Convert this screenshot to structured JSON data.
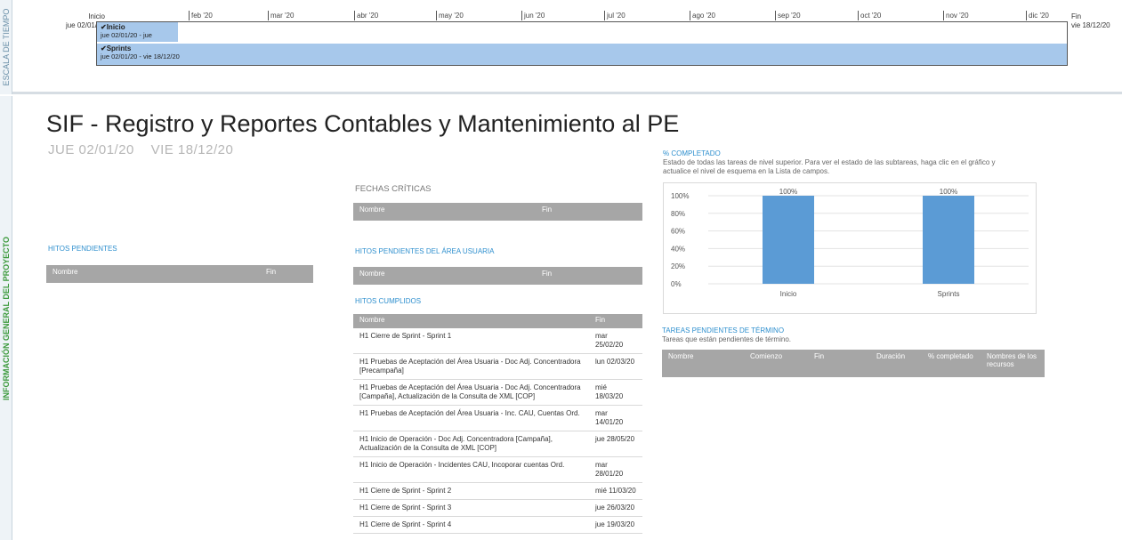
{
  "side_labels": {
    "timeline": "ESCALA DE TIEMPO",
    "info": "INFORMACIÓN GENERAL DEL PROYECTO"
  },
  "timeline": {
    "start_label": "Inicio",
    "start_date": "jue 02/01/20",
    "end_label": "Fin",
    "end_date": "vie 18/12/20",
    "months": [
      "feb '20",
      "mar '20",
      "abr '20",
      "may '20",
      "jun '20",
      "jul '20",
      "ago '20",
      "sep '20",
      "oct '20",
      "nov '20",
      "dic '20"
    ],
    "bars": [
      {
        "name": "Inicio",
        "dates": "jue 02/01/20 - jue"
      },
      {
        "name": "Sprints",
        "dates": "jue 02/01/20 - vie 18/12/20"
      }
    ]
  },
  "project": {
    "title": "SIF - Registro y Reportes Contables y Mantenimiento al PE",
    "start": "JUE 02/01/20",
    "end": "VIE 18/12/20"
  },
  "sections": {
    "hitos_pendientes": {
      "heading": "HITOS PENDIENTES",
      "col_name": "Nombre",
      "col_end": "Fin"
    },
    "fechas_criticas": {
      "heading": "FECHAS CRÍTICAS",
      "col_name": "Nombre",
      "col_end": "Fin"
    },
    "hitos_area": {
      "heading": "HITOS PENDIENTES DEL ÁREA USUARIA",
      "col_name": "Nombre",
      "col_end": "Fin"
    },
    "hitos_cumplidos": {
      "heading": "HITOS CUMPLIDOS",
      "col_name": "Nombre",
      "col_end": "Fin",
      "rows": [
        {
          "name": "H1 Cierre de Sprint - Sprint 1",
          "end": "mar 25/02/20"
        },
        {
          "name": "H1 Pruebas de Aceptación del Área Usuaria - Doc Adj. Concentradora [Precampaña]",
          "end": "lun 02/03/20"
        },
        {
          "name": "H1 Pruebas de Aceptación del Área Usuaria - Doc Adj. Concentradora [Campaña], Actualización de la Consulta de XML [COP]",
          "end": "mié 18/03/20"
        },
        {
          "name": "H1 Pruebas de Aceptación del Área Usuaria - Inc. CAU, Cuentas Ord.",
          "end": "mar 14/01/20"
        },
        {
          "name": "H1 Inicio de Operación - Doc Adj. Concentradora [Campaña], Actualización de la Consulta de XML [COP]",
          "end": "jue 28/05/20"
        },
        {
          "name": "H1 Inicio de Operación - Incidentes CAU, Incoporar cuentas Ord.",
          "end": "mar 28/01/20"
        },
        {
          "name": "H1 Cierre de Sprint - Sprint 2",
          "end": "mié 11/03/20"
        },
        {
          "name": "H1 Cierre de Sprint - Sprint 3",
          "end": "jue 26/03/20"
        },
        {
          "name": "H1 Cierre de Sprint - Sprint 4",
          "end": "jue 19/03/20"
        }
      ]
    },
    "completado": {
      "heading": "% COMPLETADO",
      "description": "Estado de todas las tareas de nivel superior. Para ver el estado de las subtareas, haga clic en el gráfico y actualice el nivel de esquema en la Lista de campos."
    },
    "tareas_pendientes": {
      "heading": "TAREAS PENDIENTES DE TÉRMINO",
      "description": "Tareas que están pendientes de término.",
      "columns": [
        "Nombre",
        "Comienzo",
        "Fin",
        "Duración",
        "% completado",
        "Nombres de los recursos"
      ]
    }
  },
  "chart_data": {
    "type": "bar",
    "categories": [
      "Inicio",
      "Sprints"
    ],
    "values": [
      100,
      100
    ],
    "data_labels": [
      "100%",
      "100%"
    ],
    "yticks": [
      "100%",
      "80%",
      "60%",
      "40%",
      "20%",
      "0%"
    ],
    "ylim": [
      0,
      100
    ],
    "color": "#5b9bd5",
    "grid": true
  }
}
